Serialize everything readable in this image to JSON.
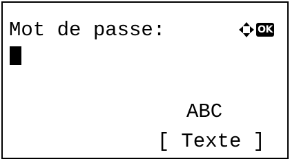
{
  "screen": {
    "title": "Mot de passe:",
    "ok_icon_label": "OK",
    "nav_icon": "four-way-arrow-icon",
    "input_value": "",
    "input_mode": "ABC",
    "softkey": {
      "open_bracket": "[",
      "label": "Texte",
      "close_bracket": "]"
    }
  }
}
